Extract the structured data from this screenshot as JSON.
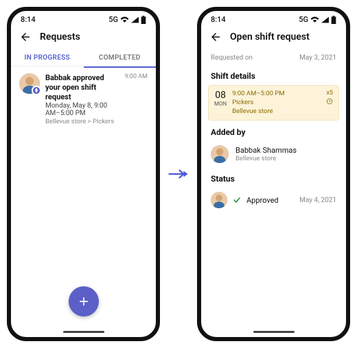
{
  "statusbar": {
    "time": "8:14",
    "network": "5G"
  },
  "left": {
    "header": {
      "title": "Requests"
    },
    "tabs": {
      "in_progress": "IN PROGRESS",
      "completed": "COMPLETED"
    },
    "item": {
      "title": "Babbak approved your open shift request",
      "subtitle": "Monday, May 8, 9:00 AM–5:00 PM",
      "meta": "Bellevue store > Pickers",
      "time": "9:00 AM"
    }
  },
  "right": {
    "header": {
      "title": "Open shift request"
    },
    "requested": {
      "label": "Requested on",
      "date": "May 3, 2021"
    },
    "shift": {
      "section": "Shift details",
      "daynum": "08",
      "dayname": "MON",
      "time": "9:00 AM–5:00 PM",
      "group": "Pickers",
      "store": "Bellevue store",
      "count": "x5"
    },
    "added": {
      "section": "Added by",
      "name": "Babbak Shammas",
      "sub": "Bellevue store"
    },
    "status": {
      "section": "Status",
      "text": "Approved",
      "date": "May 4, 2021"
    }
  }
}
